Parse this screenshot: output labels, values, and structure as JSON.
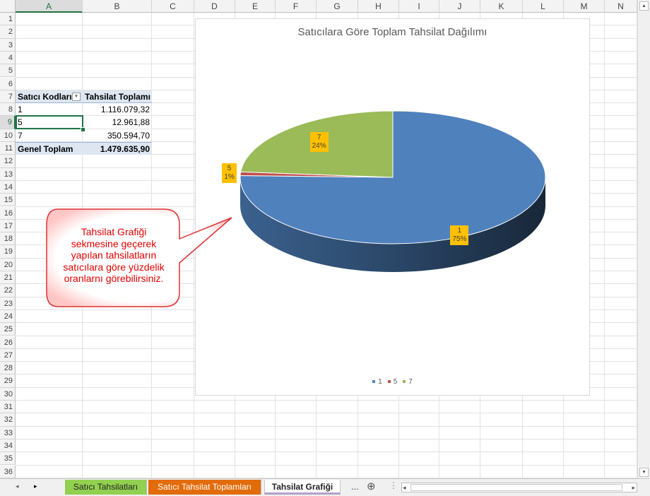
{
  "columns": [
    "A",
    "B",
    "C",
    "D",
    "E",
    "F",
    "G",
    "H",
    "I",
    "J",
    "K",
    "L",
    "M",
    "N"
  ],
  "rows": [
    "1",
    "2",
    "3",
    "4",
    "5",
    "6",
    "7",
    "8",
    "9",
    "10",
    "11",
    "12",
    "13",
    "14",
    "15",
    "16",
    "17",
    "18",
    "19",
    "20",
    "21",
    "22",
    "23",
    "24",
    "25",
    "26",
    "27",
    "28",
    "29",
    "30",
    "31",
    "32",
    "33",
    "34",
    "35",
    "36"
  ],
  "selected_cell": {
    "column": "A",
    "row": "9"
  },
  "pivot": {
    "header": {
      "col_a": "Satıcı Kodları",
      "col_b": "Tahsilat Toplamı"
    },
    "data_rows": [
      {
        "code": "1",
        "total": "1.116.079,32"
      },
      {
        "code": "5",
        "total": "12.961,88"
      },
      {
        "code": "7",
        "total": "350.594,70"
      }
    ],
    "total_row": {
      "label": "Genel Toplam",
      "total": "1.479.635,90"
    }
  },
  "chart": {
    "title": "Satıcılara Göre Toplam Tahsilat Dağılımı"
  },
  "chart_data": {
    "type": "pie",
    "title": "Satıcılara Göre Toplam Tahsilat Dağılımı",
    "categories": [
      "1",
      "5",
      "7"
    ],
    "values": [
      1116079.32,
      12961.88,
      350594.7
    ],
    "percent_labels": [
      "75%",
      "1%",
      "24%"
    ],
    "colors": [
      "#4f81bd",
      "#c0504d",
      "#9bbb59"
    ],
    "legend_position": "bottom",
    "three_d": true
  },
  "callout": {
    "lines": [
      "Tahsilat Grafiği",
      "sekmesine geçerek",
      "yapılan tahsilatların",
      "satıcılara göre yüzdelik",
      "oranlarnı görebilirsiniz."
    ]
  },
  "tabs": [
    {
      "label": "Satıcı Tahsilatları",
      "color": "#92d050",
      "active": false
    },
    {
      "label": "Satıcı Tahsilat Toplamları",
      "color": "#e26b0a",
      "active": false
    },
    {
      "label": "Tahsilat Grafiği",
      "color": "#b1a0c7",
      "active": true
    }
  ],
  "tab_more": "...",
  "tab_add": "⊕",
  "icons": {
    "nav_prev": "◂",
    "nav_next": "▸",
    "scroll_up": "▲",
    "scroll_down": "▼",
    "scroll_left": "◂",
    "scroll_right": "▸",
    "filter": "▾"
  }
}
